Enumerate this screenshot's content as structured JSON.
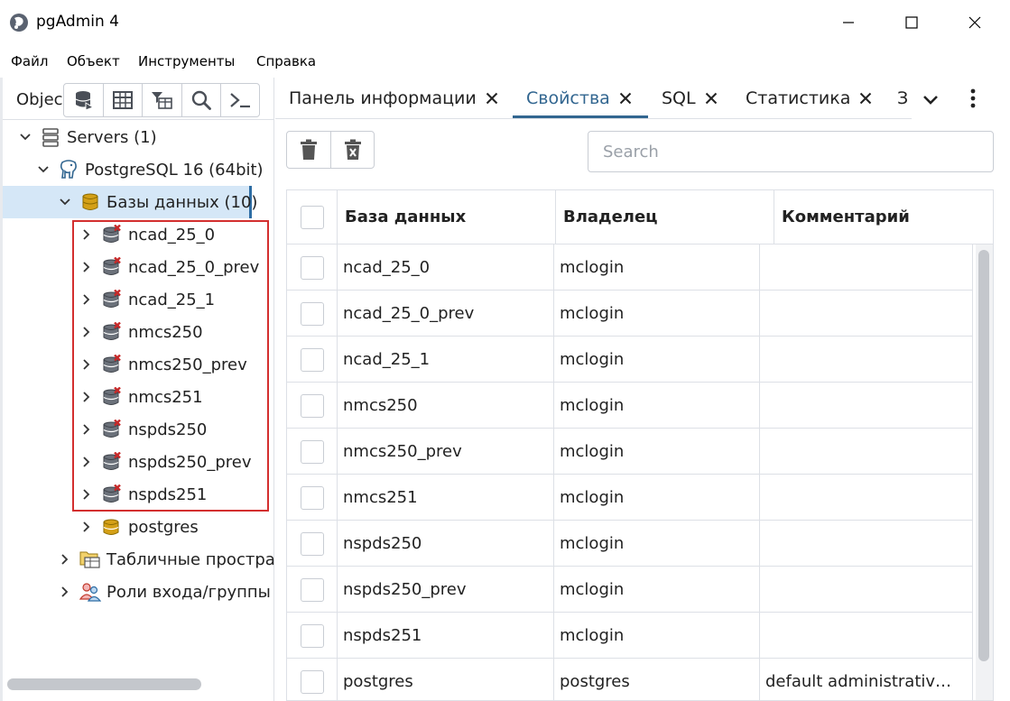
{
  "window": {
    "title": "pgAdmin 4",
    "controls": {
      "minimize": "minimize-icon",
      "maximize": "maximize-icon",
      "close": "close-icon"
    }
  },
  "menu": [
    "Файл",
    "Объект",
    "Инструменты",
    "Справка"
  ],
  "left_panel": {
    "tab_label": "Object Explorer",
    "toolbar_icons": [
      "database-query-icon",
      "table-view-icon",
      "table-filter-icon",
      "search-icon",
      "terminal-icon"
    ],
    "tree": {
      "servers": "Servers (1)",
      "server": "PostgreSQL 16 (64bit)",
      "databases_node": "Базы данных (10)",
      "databases": [
        {
          "name": "ncad_25_0",
          "status": "disconnected"
        },
        {
          "name": "ncad_25_0_prev",
          "status": "disconnected"
        },
        {
          "name": "ncad_25_1",
          "status": "disconnected"
        },
        {
          "name": "nmcs250",
          "status": "disconnected"
        },
        {
          "name": "nmcs250_prev",
          "status": "disconnected"
        },
        {
          "name": "nmcs251",
          "status": "disconnected"
        },
        {
          "name": "nspds250",
          "status": "disconnected"
        },
        {
          "name": "nspds250_prev",
          "status": "disconnected"
        },
        {
          "name": "nspds251",
          "status": "disconnected"
        },
        {
          "name": "postgres",
          "status": "connected"
        }
      ],
      "tablespaces": "Табличные простра",
      "login_roles": "Роли входа/группы"
    }
  },
  "tabs": [
    {
      "label": "Панель информации",
      "active": false
    },
    {
      "label": "Свойства",
      "active": true
    },
    {
      "label": "SQL",
      "active": false
    },
    {
      "label": "Статистика",
      "active": false
    },
    {
      "label": "З",
      "active": false
    }
  ],
  "tabs_more_icons": [
    "chevron-down-icon",
    "more-vertical-icon"
  ],
  "properties": {
    "toolbar": [
      "delete-icon",
      "delete-force-icon"
    ],
    "search_placeholder": "Search",
    "columns": [
      "База данных",
      "Владелец",
      "Комментарий"
    ],
    "rows": [
      {
        "db": "ncad_25_0",
        "owner": "mclogin",
        "comment": ""
      },
      {
        "db": "ncad_25_0_prev",
        "owner": "mclogin",
        "comment": ""
      },
      {
        "db": "ncad_25_1",
        "owner": "mclogin",
        "comment": ""
      },
      {
        "db": "nmcs250",
        "owner": "mclogin",
        "comment": ""
      },
      {
        "db": "nmcs250_prev",
        "owner": "mclogin",
        "comment": ""
      },
      {
        "db": "nmcs251",
        "owner": "mclogin",
        "comment": ""
      },
      {
        "db": "nspds250",
        "owner": "mclogin",
        "comment": ""
      },
      {
        "db": "nspds250_prev",
        "owner": "mclogin",
        "comment": ""
      },
      {
        "db": "nspds251",
        "owner": "mclogin",
        "comment": ""
      },
      {
        "db": "postgres",
        "owner": "postgres",
        "comment": "default administrativ…"
      }
    ]
  },
  "colors": {
    "accent": "#326690",
    "selected_row": "#d5e7f7",
    "highlight_box": "#d32f2f",
    "db_disconnected_mark": "#c62828",
    "db_connected": "#d4a017"
  }
}
